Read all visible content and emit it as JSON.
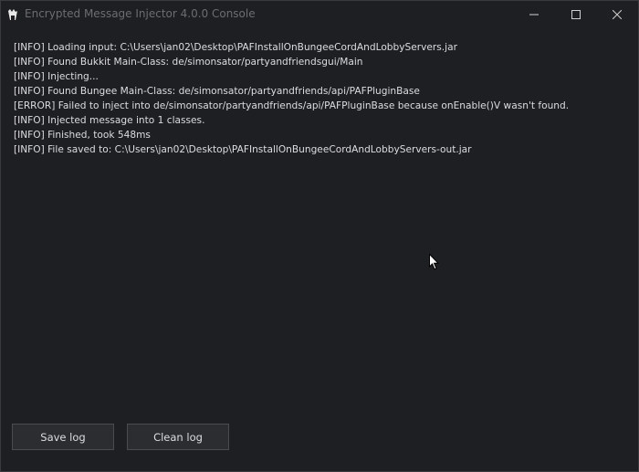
{
  "window": {
    "title": "Encrypted Message Injector 4.0.0 Console"
  },
  "log": {
    "lines": [
      "[INFO] Loading input: C:\\Users\\jan02\\Desktop\\PAFInstallOnBungeeCordAndLobbyServers.jar",
      "[INFO] Found Bukkit Main-Class: de/simonsator/partyandfriendsgui/Main",
      "[INFO] Injecting...",
      "[INFO] Found Bungee Main-Class: de/simonsator/partyandfriends/api/PAFPluginBase",
      "[ERROR] Failed to inject into de/simonsator/partyandfriends/api/PAFPluginBase because onEnable()V wasn't found.",
      "[INFO] Injected message into 1 classes.",
      "[INFO] Finished, took 548ms",
      "[INFO] File saved to: C:\\Users\\jan02\\Desktop\\PAFInstallOnBungeeCordAndLobbyServers-out.jar"
    ]
  },
  "buttons": {
    "save_label": "Save log",
    "clean_label": "Clean log"
  },
  "icons": {
    "app": "app-icon",
    "minimize": "minimize-icon",
    "maximize": "maximize-icon",
    "close": "close-icon",
    "cursor": "mouse-pointer-icon"
  },
  "colors": {
    "background": "#1e1f22",
    "text": "#dcdde0",
    "title_text": "#6b6d72",
    "button_bg": "#2b2d31",
    "button_border": "#4a4c51"
  }
}
